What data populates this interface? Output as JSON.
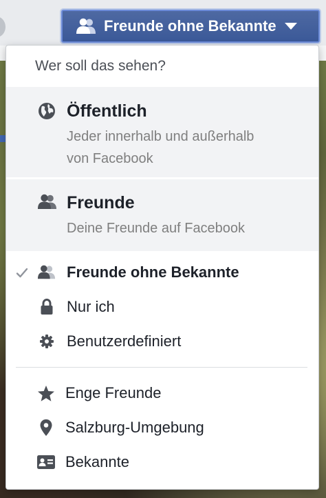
{
  "audience_button": {
    "label": "Freunde ohne Bekannte",
    "icon": "friends-icon"
  },
  "menu": {
    "header": "Wer soll das sehen?",
    "public": {
      "title": "Öffentlich",
      "description_line1": "Jeder innerhalb und außerhalb",
      "description_line2": "von Facebook",
      "icon": "globe-icon"
    },
    "friends": {
      "title": "Freunde",
      "description": "Deine Freunde auf Facebook",
      "icon": "friends-icon"
    },
    "options": [
      {
        "label": "Freunde ohne Bekannte",
        "icon": "friends-except-icon",
        "selected": true
      },
      {
        "label": "Nur ich",
        "icon": "lock-icon",
        "selected": false
      },
      {
        "label": "Benutzerdefiniert",
        "icon": "gear-icon",
        "selected": false
      }
    ],
    "lists": [
      {
        "label": "Enge Freunde",
        "icon": "star-icon"
      },
      {
        "label": "Salzburg-Umgebung",
        "icon": "location-pin-icon"
      },
      {
        "label": "Bekannte",
        "icon": "id-card-icon"
      }
    ]
  },
  "colors": {
    "button_blue": "#4e69a2",
    "button_border": "#6b8bd9",
    "highlight_bg": "#f2f3f5",
    "text_dark": "#1d2129",
    "text_muted": "#7f7f7f"
  }
}
